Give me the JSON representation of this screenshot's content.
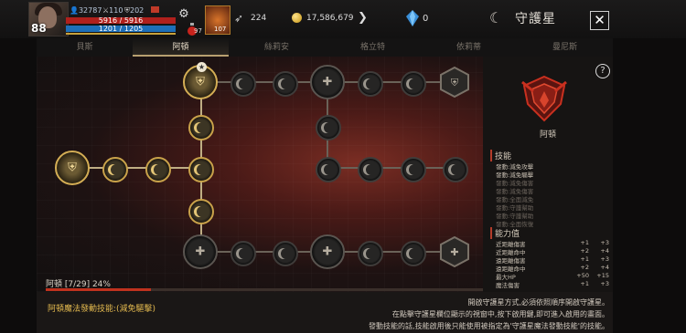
{
  "player": {
    "level": "88",
    "stat1": "32787",
    "stat2": "110",
    "stat3": "202",
    "hp_text": "5916 / 5916",
    "mp_text": "1201 / 1205",
    "potion_count": "97",
    "item_count": "107"
  },
  "currency": {
    "feathers": "224",
    "gold": "17,586,679",
    "gems": "0"
  },
  "window": {
    "logo": "☾",
    "title": "守護星",
    "close": "✕"
  },
  "tabs": [
    {
      "label": "貝斯",
      "active": false
    },
    {
      "label": "阿頓",
      "active": true
    },
    {
      "label": "絲莉安",
      "active": false
    },
    {
      "label": "格立特",
      "active": false
    },
    {
      "label": "依莉蒂",
      "active": false
    },
    {
      "label": "曼尼斯",
      "active": false
    }
  ],
  "star_badge": "★",
  "progress": {
    "label": "阿頓 [7/29] 24%",
    "fraction": 0.24
  },
  "panel": {
    "help": "?",
    "emblem_name": "阿頓",
    "skills_title": "技能",
    "skills": [
      {
        "text": "發動:減免攻擊",
        "active": true
      },
      {
        "text": "發動:減免驅擊",
        "active": true
      },
      {
        "text": "發動:減免傷害",
        "active": false
      },
      {
        "text": "發動:減免傷害",
        "active": false
      },
      {
        "text": "發動:全面減免",
        "active": false
      },
      {
        "text": "發動:守護幫助",
        "active": false
      },
      {
        "text": "發動:守護幫助",
        "active": false
      },
      {
        "text": "發動:全面恢復",
        "active": false
      }
    ],
    "stats_title": "能力值",
    "stats": [
      {
        "name": "近距離傷害",
        "a": "+1",
        "b": "+3"
      },
      {
        "name": "近距離命中",
        "a": "+2",
        "b": "+4"
      },
      {
        "name": "遠距離傷害",
        "a": "+1",
        "b": "+3"
      },
      {
        "name": "遠距離命中",
        "a": "+2",
        "b": "+4"
      },
      {
        "name": "最大HP",
        "a": "+50",
        "b": "+15"
      },
      {
        "name": "魔法傷害",
        "a": "+1",
        "b": "+3"
      }
    ]
  },
  "bottom": {
    "effect": "阿頓魔法發動技能:(減免驅擊)",
    "desc1": "開啟守護星方式,必須依照順序開啟守護星。",
    "desc2": "在點擊守護星欄位顯示的視窗中,按下啟用鍵,即可進入啟用的畫面。",
    "desc3": "發動技能的話,技能啟用後只能使用被指定為'守護星魔法發動技能'的技能。"
  },
  "colors": {
    "gold_border": "#c9a24a",
    "accent_red": "#c0321e",
    "effect_text": "#e3b94f"
  }
}
